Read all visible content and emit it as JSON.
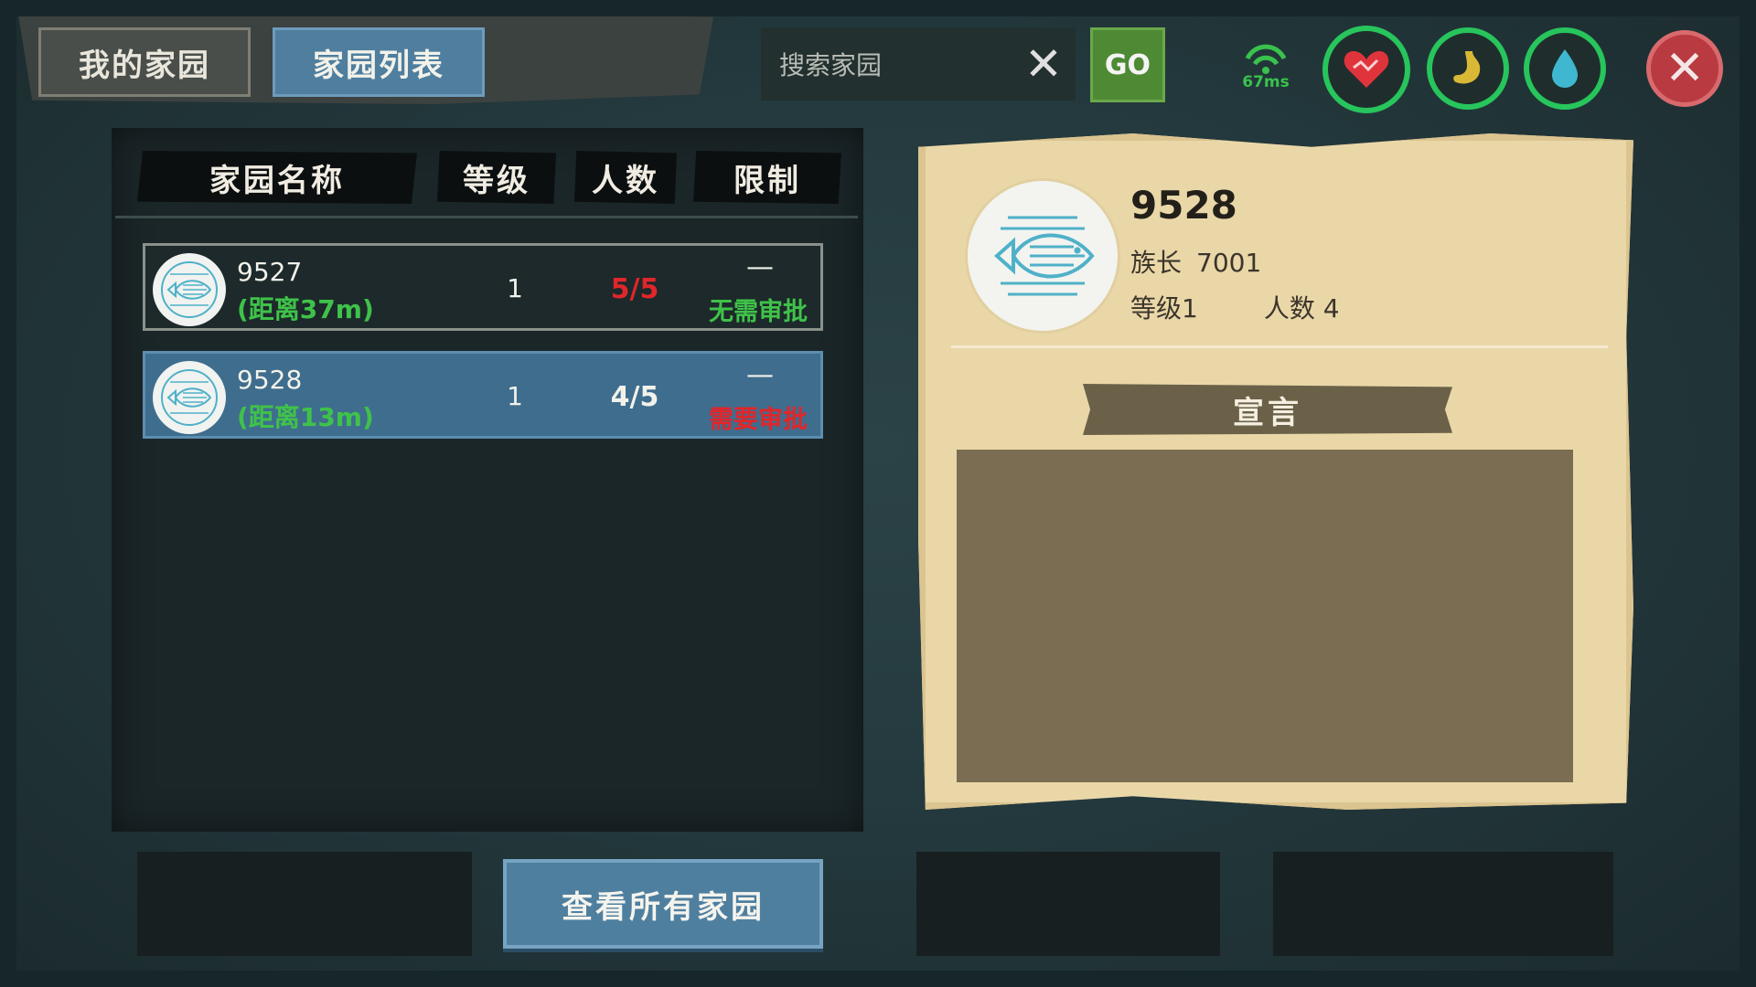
{
  "tabs": [
    {
      "label": "我的家园"
    },
    {
      "label": "家园列表"
    }
  ],
  "search": {
    "placeholder": "搜索家园",
    "clear_glyph": "✕",
    "go_label": "GO"
  },
  "status": {
    "ping": "67ms",
    "hp_icon": "heart-icon",
    "food_icon": "stomach-icon",
    "water_icon": "water-drop-icon",
    "ring_color": "#27c55c"
  },
  "close": {
    "glyph": "✕",
    "color": "#b93a40"
  },
  "list": {
    "headers": {
      "name": "家园名称",
      "level": "等级",
      "count": "人数",
      "limit": "限制"
    },
    "rows": [
      {
        "name": "9527",
        "distance": "(距离37m)",
        "level": "1",
        "count": "5/5",
        "dash": "—",
        "approval": "无需审批",
        "count_color": "#e0262a",
        "approval_color": "#3fc24a",
        "selected": false
      },
      {
        "name": "9528",
        "distance": "(距离13m)",
        "level": "1",
        "count": "4/5",
        "dash": "—",
        "approval": "需要审批",
        "count_color": "#f2f2ea",
        "approval_color": "#e0262a",
        "selected": true
      }
    ]
  },
  "detail": {
    "name": "9528",
    "leader_label": "族长",
    "leader_value": "7001",
    "level_label": "等级1",
    "count_label": "人数 4",
    "declaration_title": "宣言",
    "declaration_text": ""
  },
  "bottom": {
    "view_all_label": "查看所有家园"
  }
}
